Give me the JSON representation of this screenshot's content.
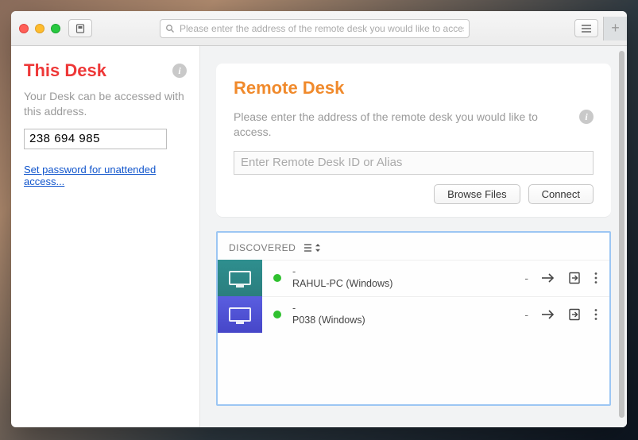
{
  "toolbar": {
    "search_placeholder": "Please enter the address of the remote desk you would like to access."
  },
  "sidebar": {
    "title": "This Desk",
    "subtitle": "Your Desk can be accessed with this address.",
    "address": "238 694 985",
    "set_password_link": "Set password for unattended access..."
  },
  "remote": {
    "title": "Remote Desk",
    "subtitle": "Please enter the address of the remote desk you would like to access.",
    "input_placeholder": "Enter Remote Desk ID or Alias",
    "browse_label": "Browse Files",
    "connect_label": "Connect"
  },
  "discovered": {
    "heading": "DISCOVERED",
    "items": [
      {
        "alias": "-",
        "name": "RAHUL-PC (Windows)",
        "status": "online",
        "tile_color": "a",
        "right_dash": "-"
      },
      {
        "alias": "-",
        "name": "P038 (Windows)",
        "status": "online",
        "tile_color": "b",
        "right_dash": "-"
      }
    ]
  }
}
